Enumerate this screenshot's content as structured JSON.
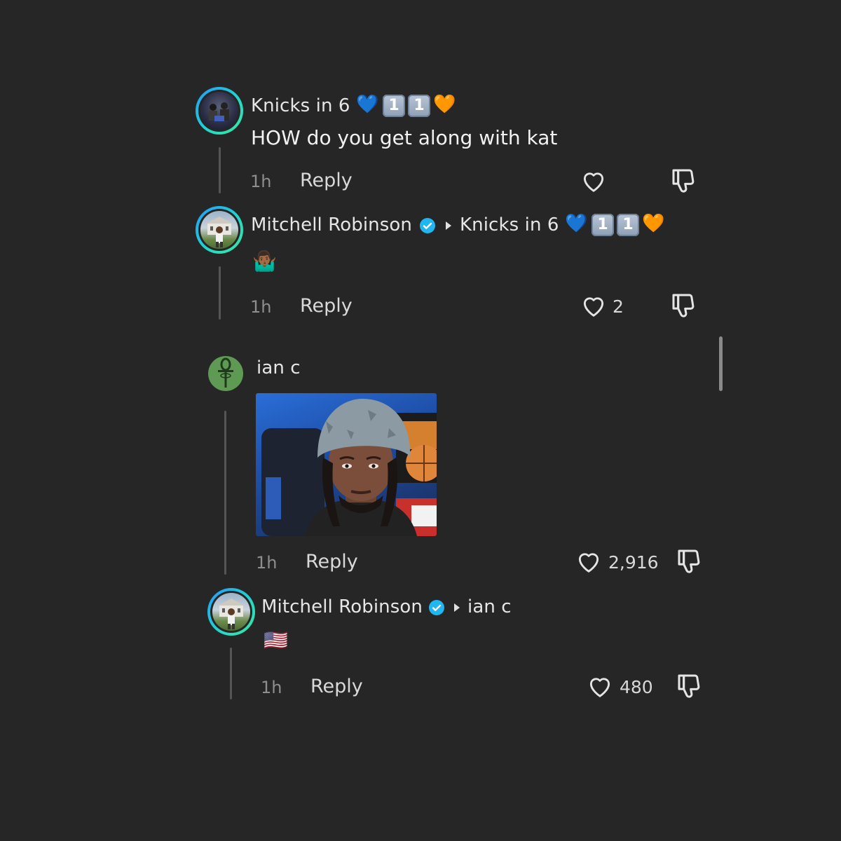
{
  "comments": [
    {
      "author": "Knicks in 6",
      "author_emoji": [
        "blue-heart",
        "keycap-1",
        "keycap-1",
        "orange-heart"
      ],
      "text": "HOW do you get along with kat",
      "time": "1h",
      "reply_label": "Reply",
      "likes": ""
    },
    {
      "author": "Mitchell Robinson",
      "verified": true,
      "reply_to": "Knicks in 6",
      "reply_to_emoji": [
        "blue-heart",
        "keycap-1",
        "keycap-1",
        "orange-heart"
      ],
      "text_emoji": "person-shrugging",
      "time": "1h",
      "reply_label": "Reply",
      "likes": "2"
    },
    {
      "author": "ian c",
      "has_image": true,
      "time": "1h",
      "reply_label": "Reply",
      "likes": "2,916"
    },
    {
      "author": "Mitchell Robinson",
      "verified": true,
      "reply_to": "ian c",
      "text_emoji": "us-flag",
      "time": "1h",
      "reply_label": "Reply",
      "likes": "480"
    }
  ],
  "keycap_digit": "1",
  "colors": {
    "background": "#262626",
    "verified": "#20b7f0",
    "ring_start": "#1e9bff",
    "ring_end": "#37e8a0"
  }
}
